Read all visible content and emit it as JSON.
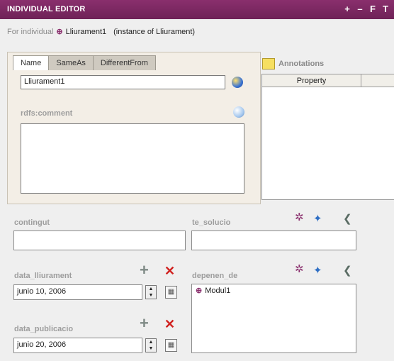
{
  "window": {
    "title": "INDIVIDUAL EDITOR",
    "controls": [
      "+",
      "–",
      "F",
      "T"
    ]
  },
  "instance": {
    "for_label": "For individual",
    "name": "Lliurament1",
    "type_text": "(instance of Lliurament)"
  },
  "tabs": [
    {
      "label": "Name",
      "active": true
    },
    {
      "label": "SameAs",
      "active": false
    },
    {
      "label": "DifferentFrom",
      "active": false
    }
  ],
  "name_field": {
    "value": "Lliurament1"
  },
  "rdfs_comment": {
    "label": "rdfs:comment",
    "value": ""
  },
  "annotations": {
    "label": "Annotations",
    "column_header": "Property"
  },
  "fields": {
    "contingut": {
      "label": "contingut",
      "value": ""
    },
    "te_solucio": {
      "label": "te_solucio",
      "value": ""
    },
    "data_lliurament": {
      "label": "data_lliurament",
      "value": "junio 10, 2006"
    },
    "depenen_de": {
      "label": "depenen_de",
      "items": [
        "Modul1"
      ]
    },
    "data_publicacio": {
      "label": "data_publicacio",
      "value": "junio 20, 2006"
    }
  },
  "icons": {
    "add": "+",
    "remove": "✕",
    "spinner_up": "▲",
    "spinner_down": "▼",
    "calendar": "▦",
    "individual": "⊕",
    "create": "✲",
    "browse": "✦",
    "back": "❮"
  },
  "colors": {
    "titlebar": "#7a2a60",
    "remove": "#d0201e",
    "panel": "#f3eee6"
  }
}
